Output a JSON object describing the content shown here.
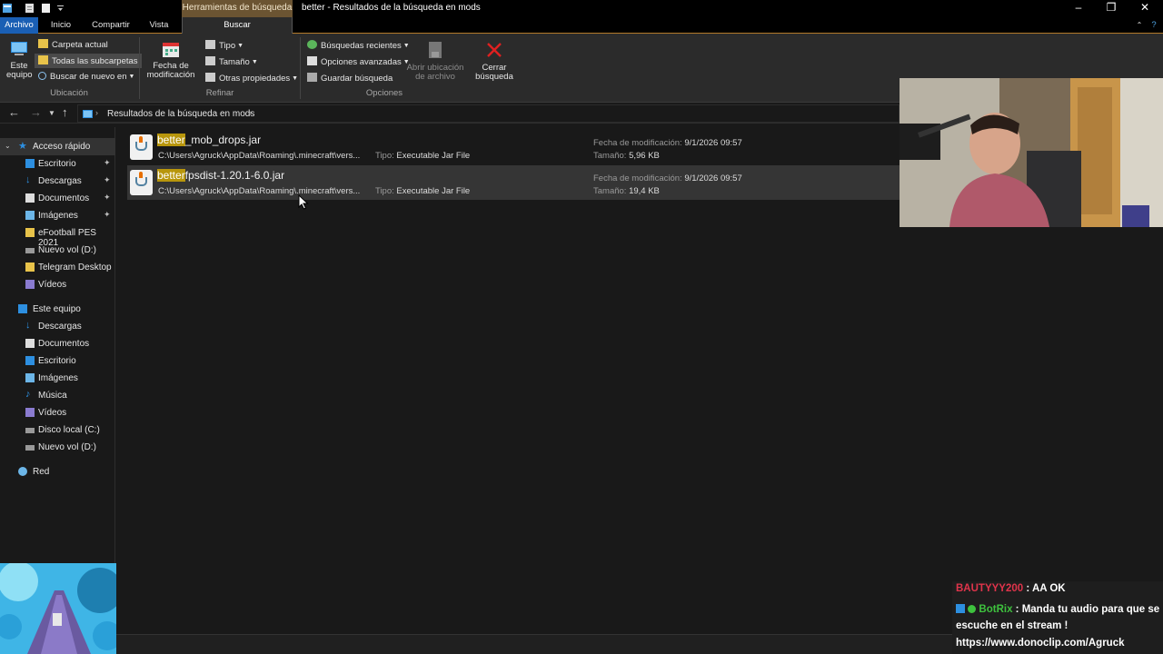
{
  "window": {
    "context_tab": "Herramientas de búsqueda",
    "title": "better - Resultados de la búsqueda en mods"
  },
  "ribbon_tabs": [
    "Archivo",
    "Inicio",
    "Compartir",
    "Vista",
    "Buscar"
  ],
  "ribbon": {
    "ubicacion": {
      "este_equipo": "Este equipo",
      "carpeta_actual": "Carpeta actual",
      "todas_subcarpetas": "Todas las subcarpetas",
      "buscar_de_nuevo": "Buscar de nuevo en",
      "label": "Ubicación"
    },
    "refinar": {
      "fecha_modificacion": "Fecha de modificación",
      "tipo": "Tipo",
      "tamano": "Tamaño",
      "otras_propiedades": "Otras propiedades",
      "label": "Refinar"
    },
    "opciones": {
      "busquedas_recientes": "Búsquedas recientes",
      "opciones_avanzadas": "Opciones avanzadas",
      "guardar_busqueda": "Guardar búsqueda",
      "abrir_ubicacion": "Abrir ubicación de archivo",
      "cerrar_busqueda": "Cerrar búsqueda",
      "label": "Opciones"
    }
  },
  "address": {
    "path": "Resultados de la búsqueda en mods"
  },
  "sidebar": {
    "quick_access": "Acceso rápido",
    "quick_items": [
      "Escritorio",
      "Descargas",
      "Documentos",
      "Imágenes",
      "eFootball PES 2021",
      "Nuevo vol (D:)",
      "Telegram Desktop",
      "Vídeos"
    ],
    "this_pc": "Este equipo",
    "pc_items": [
      "Descargas",
      "Documentos",
      "Escritorio",
      "Imágenes",
      "Música",
      "Vídeos",
      "Disco local (C:)",
      "Nuevo vol (D:)"
    ],
    "network": "Red"
  },
  "results": [
    {
      "name_highlight": "better",
      "name_rest": "_mob_drops.jar",
      "path": "C:\\Users\\Agruck\\AppData\\Roaming\\.minecraft\\vers...",
      "type_key": "Tipo:",
      "type_value": "Executable Jar File",
      "date_key": "Fecha de modificación:",
      "date_value": "9/1/2026 09:57",
      "size_key": "Tamaño:",
      "size_value": "5,96 KB"
    },
    {
      "name_highlight": "better",
      "name_rest": "fpsdist-1.20.1-6.0.jar",
      "path": "C:\\Users\\Agruck\\AppData\\Roaming\\.minecraft\\vers...",
      "type_key": "Tipo:",
      "type_value": "Executable Jar File",
      "date_key": "Fecha de modificación:",
      "date_value": "9/1/2026 09:57",
      "size_key": "Tamaño:",
      "size_value": "19,4 KB"
    }
  ],
  "chat": {
    "msg1_user": "BAUTYYY200",
    "msg1_text": ": AA OK",
    "msg2_user": "BotRix",
    "msg2_text": ": Manda tu audio para que se",
    "msg2_cont": "escuche en el stream !",
    "msg3_text": "https://www.donoclip.com/Agruck"
  },
  "colors": {
    "highlight": "#b8960c",
    "archivo_tab": "#1a5fb4",
    "context_tab": "#6b5432",
    "chat_user1": "#e0344b",
    "chat_user2": "#3ec23e"
  }
}
